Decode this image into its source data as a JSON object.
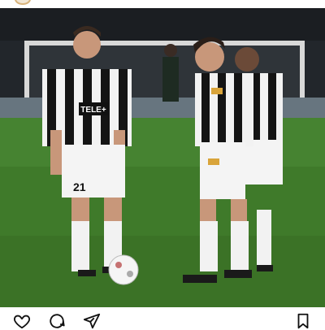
{
  "post": {
    "photo_alt": "",
    "shirt_text": "TELE+",
    "shirt_number": "21"
  },
  "actions": {
    "like_icon": "heart-outline-icon",
    "comment_icon": "speech-bubble-icon",
    "share_icon": "paper-plane-icon",
    "save_icon": "bookmark-icon"
  },
  "colors": {
    "pitch": "#3f7a2a",
    "stripe_black": "#141414",
    "stripe_white": "#f2f2f2",
    "crowd": "#23262b"
  }
}
